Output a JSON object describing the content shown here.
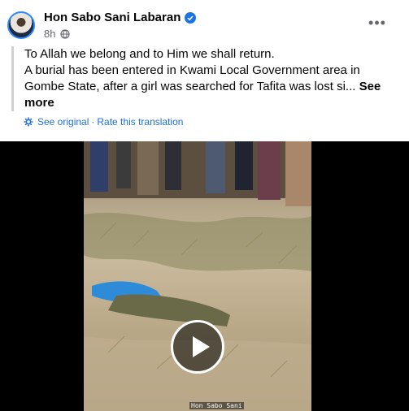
{
  "post": {
    "author": "Hon Sabo Sani Labaran",
    "verified_icon": "verified-badge-icon",
    "time": "8h",
    "audience_icon": "globe-icon",
    "more_label": "•••"
  },
  "content": {
    "line1": "To Allah we belong and to Him we shall return.",
    "line2": "A burial has been entered in Kwami Local Government area in Gombe State, after a girl was searched for Tafita was lost si...",
    "see_more": "See more"
  },
  "translation": {
    "see_original": "See original",
    "separator": "·",
    "rate": "Rate this translation"
  },
  "video": {
    "play_icon": "play-icon",
    "watermark": "Hon Sabo Sani"
  },
  "colors": {
    "link": "#216fdb",
    "verified": "#1b74e4",
    "secondary_text": "#65676b"
  }
}
